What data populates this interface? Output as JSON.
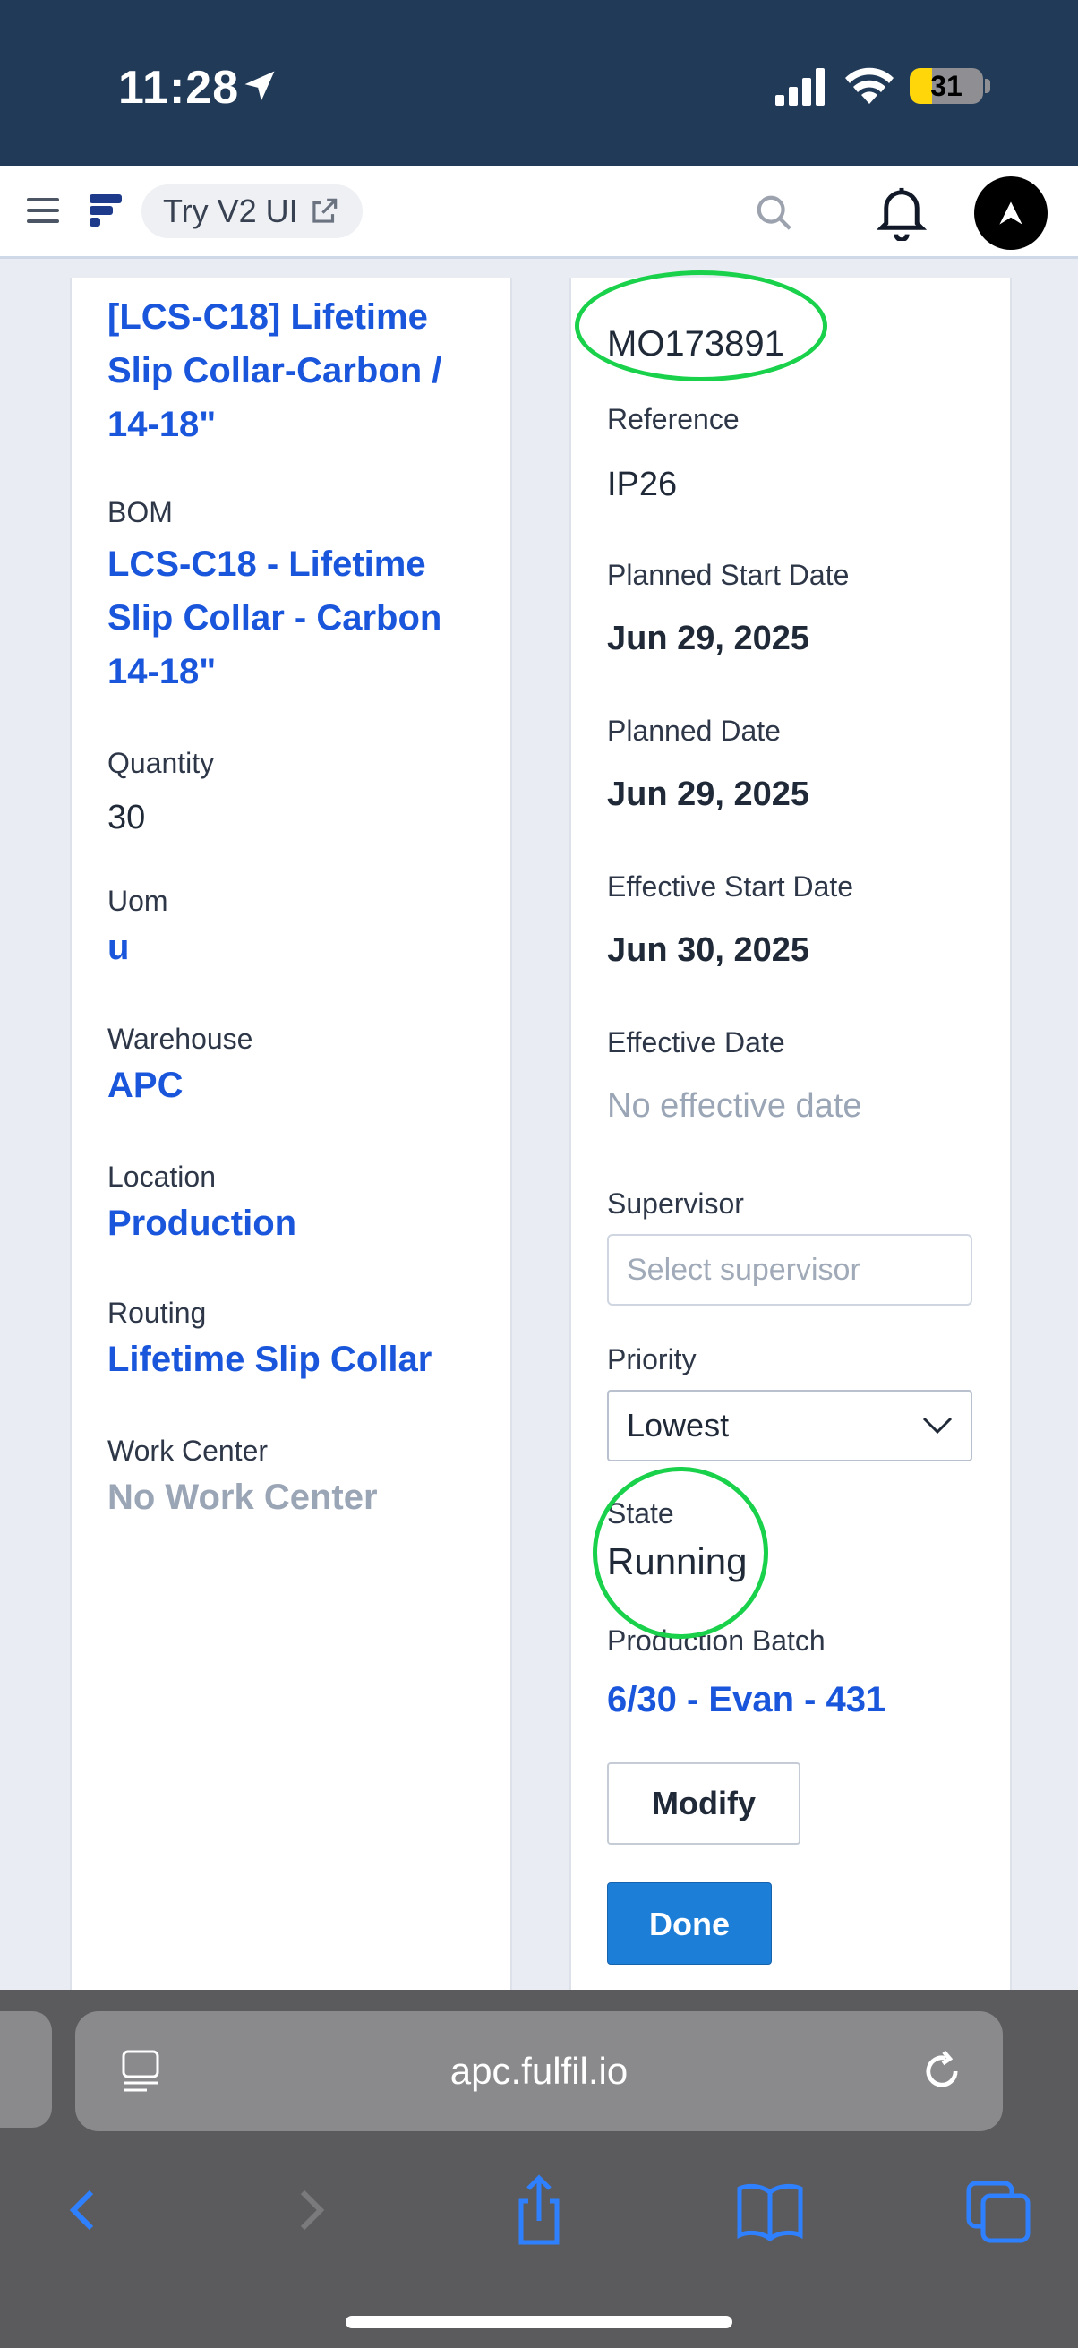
{
  "status_bar": {
    "time": "11:28",
    "battery_level": "31",
    "battery_fraction": 0.31
  },
  "header": {
    "try_v2_label": "Try V2 UI"
  },
  "left_card": {
    "product_link": "[LCS-C18] Lifetime Slip Collar-Carbon / 14-18\"",
    "bom_label": "BOM",
    "bom_value": "LCS-C18 - Lifetime Slip Collar - Carbon 14-18\"",
    "quantity_label": "Quantity",
    "quantity_value": "30",
    "uom_label": "Uom",
    "uom_value": "u",
    "warehouse_label": "Warehouse",
    "warehouse_value": "APC",
    "location_label": "Location",
    "location_value": "Production",
    "routing_label": "Routing",
    "routing_value": "Lifetime Slip Collar",
    "work_center_label": "Work Center",
    "work_center_value": "No Work Center"
  },
  "right_card": {
    "order_number": "MO173891",
    "reference_label": "Reference",
    "reference_value": "IP26",
    "planned_start_label": "Planned Start Date",
    "planned_start_value": "Jun 29, 2025",
    "planned_date_label": "Planned Date",
    "planned_date_value": "Jun 29, 2025",
    "effective_start_label": "Effective Start Date",
    "effective_start_value": "Jun 30, 2025",
    "effective_date_label": "Effective Date",
    "effective_date_value": "No effective date",
    "supervisor_label": "Supervisor",
    "supervisor_placeholder": "Select supervisor",
    "priority_label": "Priority",
    "priority_value": "Lowest",
    "state_label": "State",
    "state_value": "Running",
    "batch_label": "Production Batch",
    "batch_value": "6/30 - Evan - 431",
    "modify_button": "Modify",
    "done_button": "Done"
  },
  "browser": {
    "url": "apc.fulfil.io"
  },
  "colors": {
    "status_bar_bg": "#213a57",
    "link": "#1a56db",
    "primary_button": "#1c7ed6",
    "annotation_ring": "#19d14a",
    "muted_text": "#9aa5b6"
  },
  "icons": [
    "location-arrow-icon",
    "signal-icon",
    "wifi-icon",
    "battery-icon",
    "menu-icon",
    "fulfil-logo-icon",
    "external-link-icon",
    "search-icon",
    "bell-icon",
    "avatar-icon",
    "chevron-down-icon",
    "page-icon",
    "reload-icon",
    "back-icon",
    "forward-icon",
    "share-icon",
    "bookmarks-icon",
    "tabs-icon"
  ]
}
